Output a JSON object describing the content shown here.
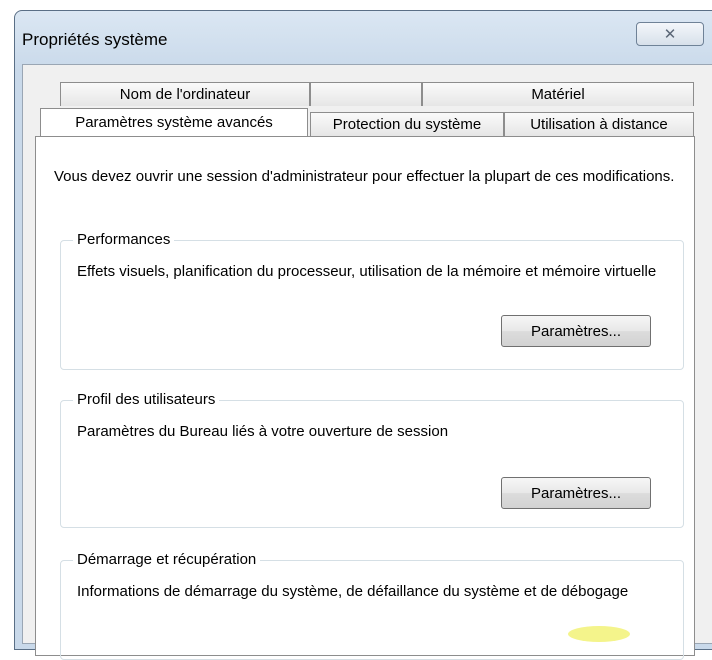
{
  "window": {
    "title": "Propriétés système",
    "close_glyph": "✕"
  },
  "tabs": {
    "row1": [
      {
        "label": "Nom de l'ordinateur"
      },
      {
        "label": ""
      },
      {
        "label": "Matériel"
      }
    ],
    "row2": [
      {
        "label": "Paramètres système avancés"
      },
      {
        "label": "Protection du système"
      },
      {
        "label": "Utilisation à distance"
      }
    ]
  },
  "panel": {
    "intro": "Vous devez ouvrir une session d'administrateur pour effectuer la plupart de ces modifications.",
    "performances": {
      "legend": "Performances",
      "description": "Effets visuels, planification du processeur, utilisation de la mémoire et mémoire virtuelle",
      "button": "Paramètres..."
    },
    "profil": {
      "legend": "Profil des utilisateurs",
      "description": "Paramètres du Bureau liés à votre ouverture de session",
      "button": "Paramètres..."
    },
    "demarrage": {
      "legend": "Démarrage et récupération",
      "description": "Informations de démarrage du système, de défaillance du système et de débogage"
    }
  },
  "colors": {
    "frame": "#c9d9ea",
    "highlight": "#f0f05a"
  }
}
